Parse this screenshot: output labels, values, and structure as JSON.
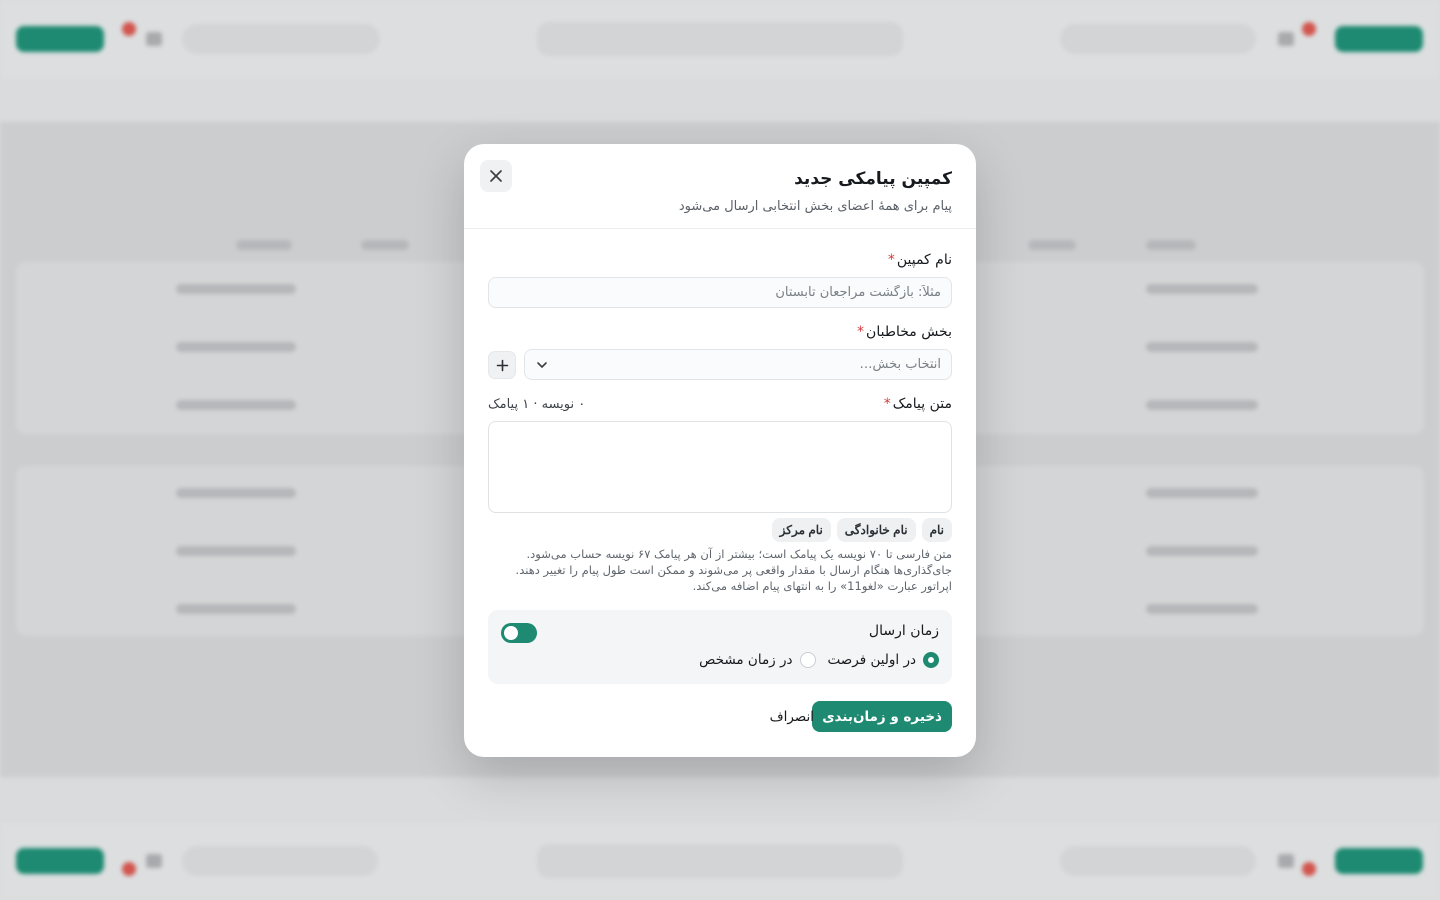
{
  "modal": {
    "title": "کمپین پیامکی جدید",
    "subtitle": "پیام برای همهٔ اعضای بخش انتخابی ارسال می‌شود",
    "campaign_name_label": "نام کمپین",
    "campaign_name_placeholder": "مثلاً: بازگشت مراجعان تابستان",
    "segment_label": "بخش مخاطبان",
    "segment_placeholder": "انتخاب بخش…",
    "message_label": "متن پیامک",
    "message_counter": "۰ نویسه · ۱ پیامک",
    "required_mark": "*",
    "placeholders": [
      "نام",
      "نام خانوادگی",
      "نام مرکز"
    ],
    "help_text": "متن فارسی تا ۷۰ نویسه یک پیامک است؛ بیشتر از آن هر پیامک ۶۷ نویسه حساب می‌شود. جای‌گذاری‌ها هنگام ارسال با مقدار واقعی پر می‌شوند و ممکن است طول پیام را تغییر دهند. اپراتور عبارت «لغو11» را به انتهای پیام اضافه می‌کند.",
    "schedule_label": "زمان ارسال",
    "schedule_option_asap": "در اولین فرصت",
    "schedule_option_specific": "در زمان مشخص",
    "save_button": "ذخیره و زمان‌بندی",
    "cancel_button": "انصراف"
  },
  "colors": {
    "accent": "#1d8a71",
    "required": "#d83a3a"
  }
}
